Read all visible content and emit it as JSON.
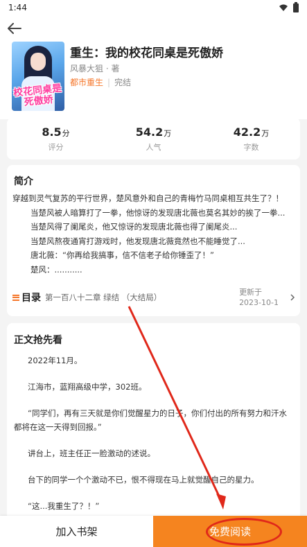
{
  "status_bar": {
    "time": "1:44"
  },
  "book": {
    "title": "重生：我的校花同桌是死傲娇",
    "author": "风暴大狙 · 著",
    "genre": "都市重生",
    "status": "完结",
    "cover_text": "校花同桌是死傲娇"
  },
  "stats": [
    {
      "value": "8.5",
      "unit": "分",
      "label": "评分"
    },
    {
      "value": "54.2",
      "unit": "万",
      "label": "人气"
    },
    {
      "value": "42.2",
      "unit": "万",
      "label": "字数"
    }
  ],
  "intro": {
    "title": "简介",
    "lines": [
      "穿越到灵气复苏的平行世界，楚风意外和自己的青梅竹马同桌相互共生了？！",
      "当楚风被人暗算打了一拳，他惊讶的发现唐北薇也莫名其妙的挨了一拳...",
      "当楚风得了阑尾炎，他又惊讶的发现唐北薇也得了阑尾炎...",
      "当楚风熬夜通宵打游戏时，他发现唐北薇竟然也不能睡觉了...",
      "唐北薇：“你再给我搞事，信不信老子给你锤歪了！”",
      "楚风：..........."
    ]
  },
  "toc": {
    "label": "目录",
    "latest_chapter": "第一百八十二章 绿结 （大结局）",
    "update_label": "更新于",
    "update_date": "2023-10-1"
  },
  "preview": {
    "title": "正文抢先看",
    "paragraphs": [
      "2022年11月。",
      "江海市，蓝翔高级中学，302班。",
      "“同学们，再有三天就是你们觉醒星力的日子，你们付出的所有努力和汗水都将在这一天得到回报。”",
      "讲台上，班主任正一脸激动的述说。",
      "台下的同学一个个激动不已，恨不得现在马上就觉醒自己的星力。",
      "“这...我重生了？！”"
    ]
  },
  "actions": {
    "add_shelf": "加入书架",
    "read_free": "免费阅读"
  },
  "colors": {
    "accent": "#f5841f",
    "annotation": "#e0281a"
  }
}
